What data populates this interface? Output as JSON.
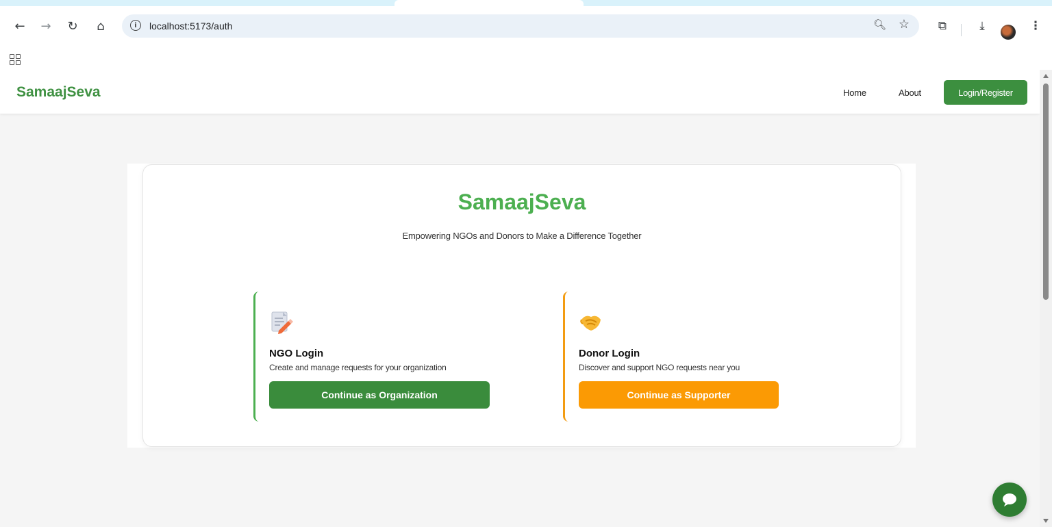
{
  "browser": {
    "url": "localhost:5173/auth",
    "icons": {
      "back": "arrow-left-icon",
      "forward": "arrow-right-icon",
      "reload": "reload-icon",
      "home": "home-icon",
      "site_info": "info-icon",
      "zoom": "zoom-icon",
      "bookmark": "star-icon",
      "extensions": "puzzle-icon",
      "downloads": "download-icon",
      "menu": "kebab-menu-icon",
      "apps": "apps-grid-icon"
    }
  },
  "navbar": {
    "brand": "SamaajSeva",
    "links": [
      "Home",
      "About"
    ],
    "cta": "Login/Register"
  },
  "hero": {
    "title": "SamaajSeva",
    "subtitle": "Empowering NGOs and Donors to Make a Difference Together"
  },
  "options": {
    "ngo": {
      "icon": "memo-pencil-icon",
      "title": "NGO Login",
      "description": "Create and manage requests for your organization",
      "button": "Continue as Organization"
    },
    "donor": {
      "icon": "handshake-icon",
      "title": "Donor Login",
      "description": "Discover and support NGO requests near you",
      "button": "Continue as Supporter"
    }
  },
  "chat": {
    "icon": "chat-bubble-icon"
  },
  "colors": {
    "brand_green": "#3f9142",
    "title_green": "#4caf50",
    "button_green": "#3a8c3c",
    "button_orange": "#fb9a04",
    "fab_green": "#2e7d32"
  }
}
